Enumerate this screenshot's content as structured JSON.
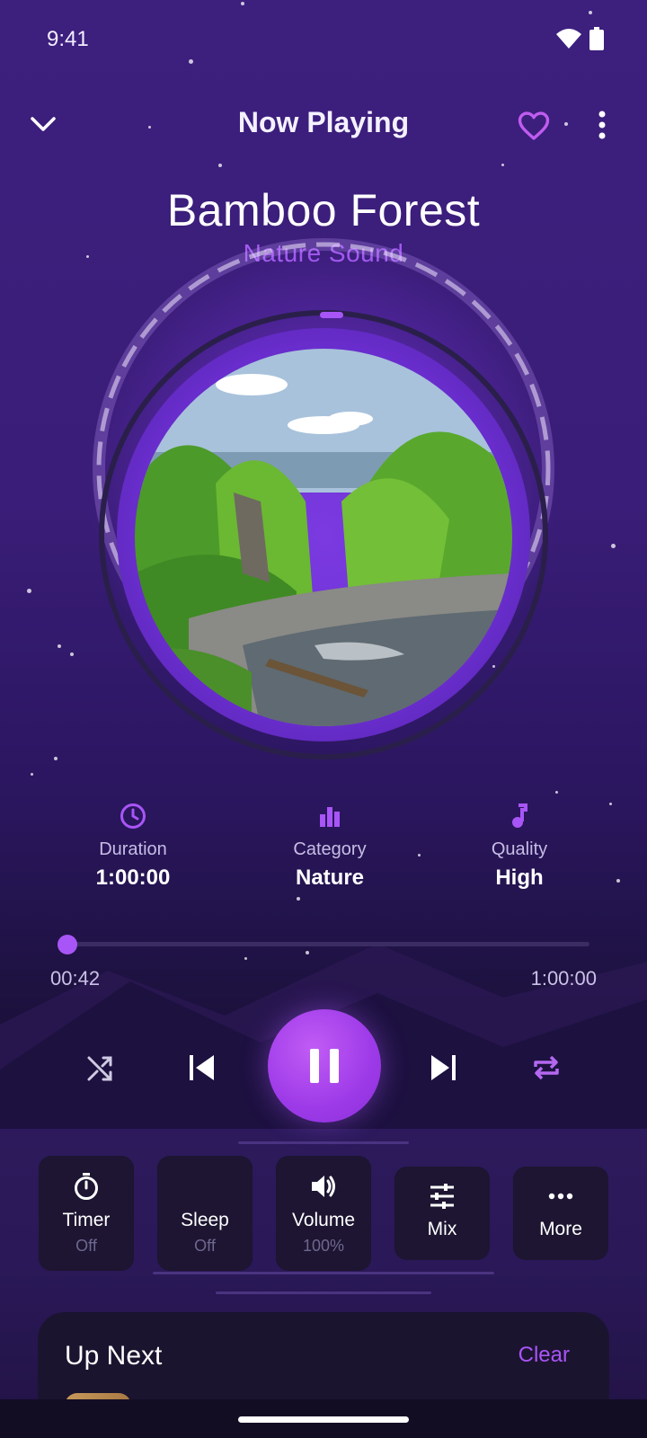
{
  "status_bar": {
    "time": "9:41"
  },
  "header": {
    "title": "Now Playing"
  },
  "track": {
    "title": "Bamboo Forest",
    "subtitle": "Nature Sound"
  },
  "info": [
    {
      "label": "Duration",
      "value": "1:00:00",
      "icon": "clock-icon"
    },
    {
      "label": "Category",
      "value": "Nature",
      "icon": "bar-chart-icon"
    },
    {
      "label": "Quality",
      "value": "High",
      "icon": "music-note-icon"
    }
  ],
  "progress": {
    "elapsed": "00:42",
    "total": "1:00:00",
    "fraction": 0.012
  },
  "tiles": [
    {
      "label": "Timer",
      "sub": "Off",
      "icon": "stopwatch-icon"
    },
    {
      "label": "Sleep",
      "sub": "Off",
      "icon": "moon-icon"
    },
    {
      "label": "Volume",
      "sub": "100%",
      "icon": "speaker-icon"
    },
    {
      "label": "Mix",
      "sub": "",
      "icon": "sliders-icon"
    },
    {
      "label": "More",
      "sub": "",
      "icon": "more-horizontal-icon"
    }
  ],
  "up_next": {
    "title": "Up Next",
    "clear_label": "Clear"
  },
  "colors": {
    "accent": "#a855f7",
    "background": "#3a1d78",
    "tile": "#1d1531"
  }
}
